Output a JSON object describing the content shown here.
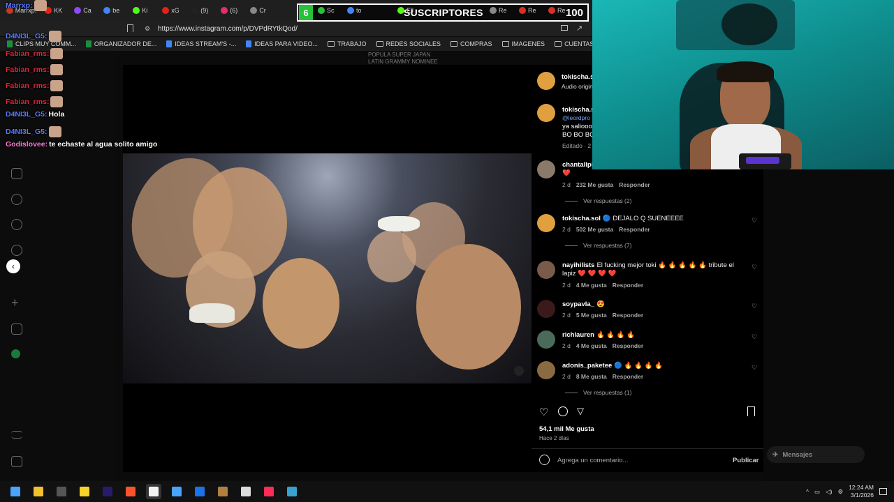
{
  "browser": {
    "url": "https://www.instagram.com/p/DVPdRYtkQod/",
    "tabs": [
      {
        "label": "Marrxp:",
        "color": "#c0392b"
      },
      {
        "label": "KK",
        "color": "#e62117"
      },
      {
        "label": "Ca",
        "color": "#9146ff"
      },
      {
        "label": "be",
        "color": "#4285f4"
      },
      {
        "label": "Ki",
        "color": "#53fc18"
      },
      {
        "label": "xG",
        "color": "#e62117"
      },
      {
        "label": "(9)",
        "color": "#222"
      },
      {
        "label": "(6)",
        "color": "#e1306c"
      },
      {
        "label": "Cr",
        "color": "#888"
      }
    ],
    "tabs_right": [
      {
        "label": "Sc",
        "color": "#27c23a"
      },
      {
        "label": "to",
        "color": "#4285f4"
      },
      {
        "label": "Ell",
        "color": "#53fc18"
      },
      {
        "label": "Re",
        "color": "#888"
      },
      {
        "label": "Re",
        "color": "#d93025"
      },
      {
        "label": "Re",
        "color": "#d93025"
      }
    ],
    "bookmarks": [
      {
        "label": "CLIPS MUY COMM...",
        "type": "sheet",
        "color": "#1e8e3e"
      },
      {
        "label": "ORGANIZADOR DE...",
        "type": "sheet",
        "color": "#1e8e3e"
      },
      {
        "label": "IDEAS STREAM'S -...",
        "type": "doc",
        "color": "#4285f4"
      },
      {
        "label": "IDEAS PARA VIDEO...",
        "type": "doc",
        "color": "#4285f4"
      },
      {
        "label": "TRABAJO",
        "type": "folder"
      },
      {
        "label": "REDES SOCIALES",
        "type": "folder"
      },
      {
        "label": "COMPRAS",
        "type": "folder"
      },
      {
        "label": "IMAGENES",
        "type": "folder"
      },
      {
        "label": "CUENTAS",
        "type": "folder"
      },
      {
        "label": "IA",
        "type": "folder"
      },
      {
        "label": "F",
        "type": "folder"
      }
    ]
  },
  "subs_overlay": {
    "badge": "6",
    "label": "SUSCRIPTORES",
    "count": "100"
  },
  "background_text": {
    "line1": "POPULA SUPER JAPAN",
    "line2": "LATIN GRAMMY NOMINEE"
  },
  "chat": [
    {
      "user": "Marrxp:",
      "text": "",
      "color": "#5b7bff",
      "emote": true
    },
    {
      "user": "D4NI3L_G5:",
      "text": "",
      "color": "#5b7bff",
      "emote": true
    },
    {
      "user": "Fabian_rms:",
      "text": "",
      "color": "#e0263f",
      "emote": true
    },
    {
      "user": "Fabian_rms:",
      "text": "",
      "color": "#e0263f",
      "emote": true
    },
    {
      "user": "Fabian_rms:",
      "text": "",
      "color": "#e0263f",
      "emote": true
    },
    {
      "user": "Fabian_rms:",
      "text": "",
      "color": "#e0263f",
      "emote": true
    },
    {
      "user": "D4NI3L_G5:",
      "text": "Hola",
      "color": "#5b7bff",
      "emote": false
    },
    {
      "user": "D4NI3L_G5:",
      "text": "",
      "color": "#5b7bff",
      "emote": true
    },
    {
      "user": "Godislovee:",
      "text": "te echaste al agua solito amigo",
      "color": "#ff7bd6",
      "emote": false
    }
  ],
  "post": {
    "header_user": "tokischa.sc",
    "header_sub": "Audio origin",
    "caption_user": "tokischa.so",
    "caption_mention": "@leordpro",
    "caption_line2": "ya salioooo",
    "caption_line3": "BO BO BO",
    "caption_meta": "Editado · 2 d",
    "likes": "54,1 mil Me gusta",
    "posted": "Hace 2 días",
    "comment_placeholder": "Agrega un comentario...",
    "publish": "Publicar",
    "messages": "Mensajes"
  },
  "comments": [
    {
      "user": "chantallpi",
      "text": "cultura, ama su gente y graba con to' el mundo ❤️",
      "time": "2 d",
      "likes": "232 Me gusta",
      "reply": "Responder",
      "more": "Ver respuestas (2)",
      "color": "#8a7a6a"
    },
    {
      "user": "tokischa.sol",
      "text": "🔵 DEJALO Q SUENEEEE",
      "time": "2 d",
      "likes": "502 Me gusta",
      "reply": "Responder",
      "more": "Ver respuestas (7)",
      "color": "#e0a040"
    },
    {
      "user": "nayihilists",
      "text": "El fucking mejor toki 🔥 🔥 🔥 🔥 🔥 tribute el lapiz ❤️ ❤️ ❤️ ❤️",
      "time": "2 d",
      "likes": "4 Me gusta",
      "reply": "Responder",
      "more": "",
      "color": "#7a5a4a"
    },
    {
      "user": "soypavla_",
      "text": "😍",
      "time": "2 d",
      "likes": "5 Me gusta",
      "reply": "Responder",
      "more": "",
      "color": "#3a1a1a"
    },
    {
      "user": "richlauren",
      "text": "🔥 🔥 🔥 🔥",
      "time": "2 d",
      "likes": "4 Me gusta",
      "reply": "Responder",
      "more": "",
      "color": "#4a6a5a"
    },
    {
      "user": "adonis_paketee",
      "text": "🔵 🔥 🔥 🔥 🔥",
      "time": "2 d",
      "likes": "8 Me gusta",
      "reply": "Responder",
      "more": "Ver respuestas (1)",
      "color": "#8a6a40"
    }
  ],
  "taskbar": {
    "time": "12:24 AM",
    "date": "3/1/2026",
    "apps": [
      {
        "name": "windows",
        "color": "#4aa3ff"
      },
      {
        "name": "files",
        "color": "#f2c12e"
      },
      {
        "name": "obs",
        "color": "#555"
      },
      {
        "name": "yellow-app",
        "color": "#f7d32a"
      },
      {
        "name": "premiere",
        "color": "#2a1a6a"
      },
      {
        "name": "brave",
        "color": "#fb542b"
      },
      {
        "name": "notepad",
        "color": "#f2f2f2"
      },
      {
        "name": "docs",
        "color": "#4aa3ff"
      },
      {
        "name": "chrome",
        "color": "#1a73e8"
      },
      {
        "name": "package",
        "color": "#b08040"
      },
      {
        "name": "capcut",
        "color": "#dddddd"
      },
      {
        "name": "tiktok",
        "color": "#fe2c55"
      },
      {
        "name": "globe",
        "color": "#3aa0d0"
      }
    ]
  }
}
